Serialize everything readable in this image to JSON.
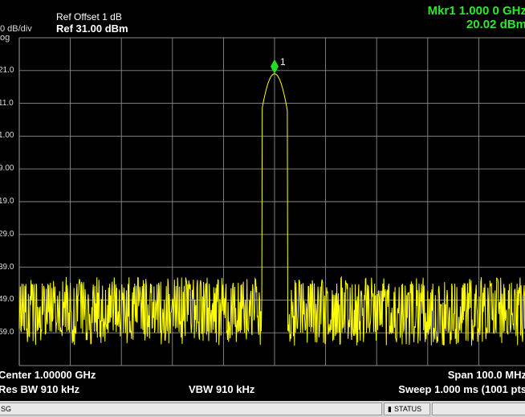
{
  "header": {
    "scale": "0 dB/div",
    "log": "og",
    "ref_offset": "Ref Offset 1 dB",
    "ref_level": "Ref 31.00 dBm",
    "marker_freq": "Mkr1 1.000 0 GHz",
    "marker_amp": "20.02 dBm"
  },
  "marker": {
    "label": "1",
    "x_ghz": 1.0,
    "y_dbm": 20.02
  },
  "footer": {
    "center": "Center 1.00000 GHz",
    "span": "Span 100.0 MHz",
    "res_bw": "Res BW 910 kHz",
    "vbw": "VBW 910 kHz",
    "sweep": "Sweep  1.000 ms (1001 pts"
  },
  "status_bar": {
    "left": "SG",
    "status": "STATUS"
  },
  "colors": {
    "trace": "#ffff00",
    "marker": "#22dd22",
    "grid": "#8c8c8c",
    "marker_text": "#2ee82e"
  },
  "chart_data": {
    "type": "line",
    "x_range_ghz": [
      0.95,
      1.05
    ],
    "y_range_dbm": [
      -69,
      31
    ],
    "y_tick_labels": [
      "21.0",
      "11.0",
      "1.00",
      "9.00",
      "19.0",
      "29.0",
      "39.0",
      "49.0",
      "59.0"
    ],
    "noise_floor_dbm": [
      -59,
      -44
    ],
    "peak": {
      "x_ghz": 1.0,
      "y_dbm": 20.02
    },
    "grid": true
  }
}
